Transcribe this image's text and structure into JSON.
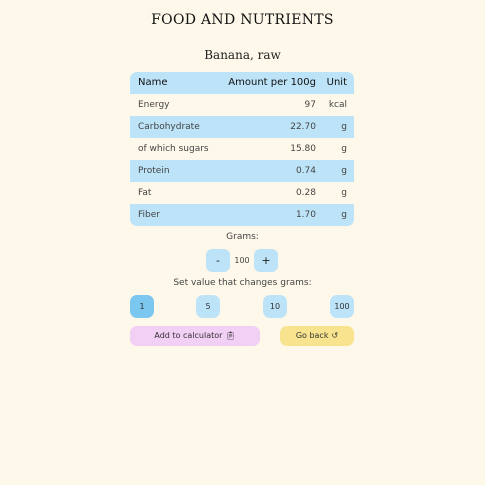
{
  "header": {
    "title": "FOOD AND NUTRIENTS",
    "food_name": "Banana, raw"
  },
  "table": {
    "columns": [
      "Name",
      "Amount per 100g",
      "Unit"
    ],
    "rows": [
      {
        "name": "Energy",
        "amount": "97",
        "unit": "kcal"
      },
      {
        "name": "Carbohydrate",
        "amount": "22.70",
        "unit": "g"
      },
      {
        "name": "of which sugars",
        "amount": "15.80",
        "unit": "g"
      },
      {
        "name": "Protein",
        "amount": "0.74",
        "unit": "g"
      },
      {
        "name": "Fat",
        "amount": "0.28",
        "unit": "g"
      },
      {
        "name": "Fiber",
        "amount": "1.70",
        "unit": "g"
      }
    ]
  },
  "grams": {
    "label": "Grams:",
    "decrement_label": "-",
    "value": "100",
    "increment_label": "+"
  },
  "step": {
    "label": "Set value that changes grams:",
    "options": [
      "1",
      "5",
      "10",
      "100"
    ],
    "selected": "1"
  },
  "actions": {
    "add_label": "Add to calculator",
    "add_icon": "clipboard-icon",
    "back_label": "Go back",
    "back_icon": "undo-arrow-icon"
  },
  "colors": {
    "background": "#fdf8ea",
    "table_blue": "#bde3f8",
    "active_blue": "#7cc7f0",
    "add_pink": "#f2cff5",
    "back_yellow": "#f8e38e"
  }
}
